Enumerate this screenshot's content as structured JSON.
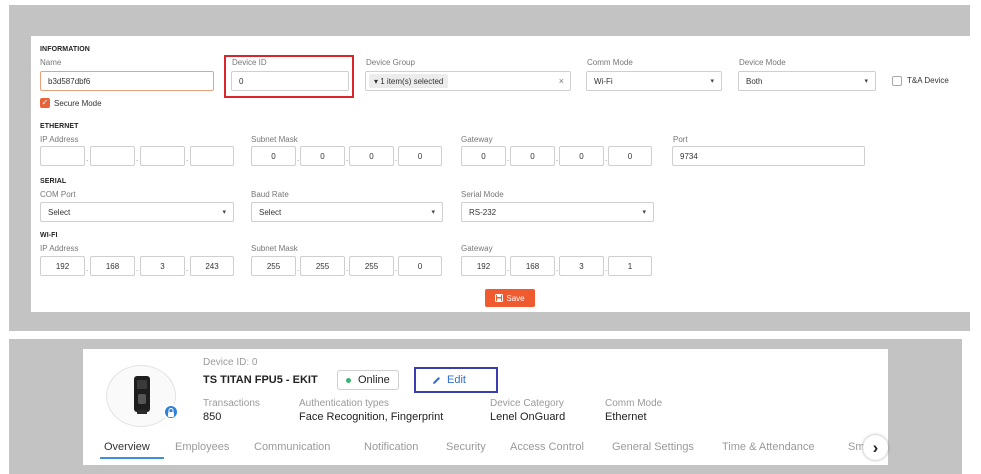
{
  "form": {
    "information": {
      "section_title": "INFORMATION",
      "name_label": "Name",
      "name_value": "b3d587dbf6",
      "device_id_label": "Device ID",
      "device_id_value": "0",
      "device_group_label": "Device Group",
      "device_group_tag": "▾ 1 item(s) selected",
      "device_group_clear": "×",
      "comm_mode_label": "Comm Mode",
      "comm_mode_value": "Wi-Fi",
      "device_mode_label": "Device Mode",
      "device_mode_value": "Both",
      "ta_device_label": "T&A Device",
      "secure_mode_label": "Secure Mode",
      "secure_mode_checked": true,
      "ta_device_checked": false
    },
    "ethernet": {
      "section_title": "ETHERNET",
      "ip_label": "IP Address",
      "ip_octets": [
        "",
        "",
        "",
        ""
      ],
      "subnet_label": "Subnet Mask",
      "subnet_octets": [
        "0",
        "0",
        "0",
        "0"
      ],
      "gateway_label": "Gateway",
      "gateway_octets": [
        "0",
        "0",
        "0",
        "0"
      ],
      "port_label": "Port",
      "port_value": "9734"
    },
    "serial": {
      "section_title": "SERIAL",
      "com_port_label": "COM Port",
      "com_port_value": "Select",
      "baud_rate_label": "Baud Rate",
      "baud_rate_value": "Select",
      "serial_mode_label": "Serial Mode",
      "serial_mode_value": "RS-232"
    },
    "wifi": {
      "section_title": "WI-FI",
      "ip_label": "IP Address",
      "ip_octets": [
        "192",
        "168",
        "3",
        "243"
      ],
      "subnet_label": "Subnet Mask",
      "subnet_octets": [
        "255",
        "255",
        "255",
        "0"
      ],
      "gateway_label": "Gateway",
      "gateway_octets": [
        "192",
        "168",
        "3",
        "1"
      ]
    },
    "save_label": "Save",
    "dot": ".",
    "caret": "▾"
  },
  "device_card": {
    "device_id_text": "Device ID: 0",
    "device_name": "TS TITAN FPU5 - EKIT",
    "status": "Online",
    "status_color": "#3cb371",
    "edit_label": "Edit",
    "transactions_label": "Transactions",
    "transactions_value": "850",
    "auth_types_label": "Authentication types",
    "auth_types_value": "Face Recognition, Fingerprint",
    "category_label": "Device Category",
    "category_value": "Lenel OnGuard",
    "comm_mode_label": "Comm Mode",
    "comm_mode_value": "Ethernet",
    "tabs": [
      "Overview",
      "Employees",
      "Communication",
      "Notification",
      "Security",
      "Access Control",
      "General Settings",
      "Time & Attendance",
      "Sm"
    ],
    "active_tab": "Overview",
    "next_arrow": "›"
  },
  "colors": {
    "accent_orange": "#ef5a2f",
    "highlight_red": "#d8262c",
    "highlight_blue": "#3a3fae",
    "active_tab_underline": "#3f8fd8"
  }
}
